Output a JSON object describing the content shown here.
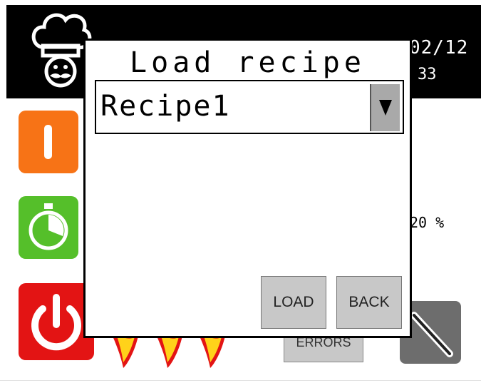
{
  "header": {
    "date": "02/12",
    "time": "33"
  },
  "status": {
    "percent": "20 %"
  },
  "buttons": {
    "errors_label": "ERRORS"
  },
  "dialog": {
    "title": "Load recipe",
    "selected_recipe": "Recipe1",
    "load_label": "LOAD",
    "back_label": "BACK"
  },
  "icons": {
    "logo": "chef-icon",
    "temperature": "thermometer-icon",
    "timer": "stopwatch-icon",
    "power": "power-icon",
    "settings": "wrench-icon",
    "dropdown": "triangle-down-icon",
    "flames": "flame-icon"
  },
  "colors": {
    "header_bg": "#000000",
    "temperature_btn": "#f77316",
    "timer_btn": "#55bf2a",
    "power_btn": "#e31414",
    "settings_btn": "#6d6d6d",
    "dialog_button": "#c8c8c8"
  }
}
